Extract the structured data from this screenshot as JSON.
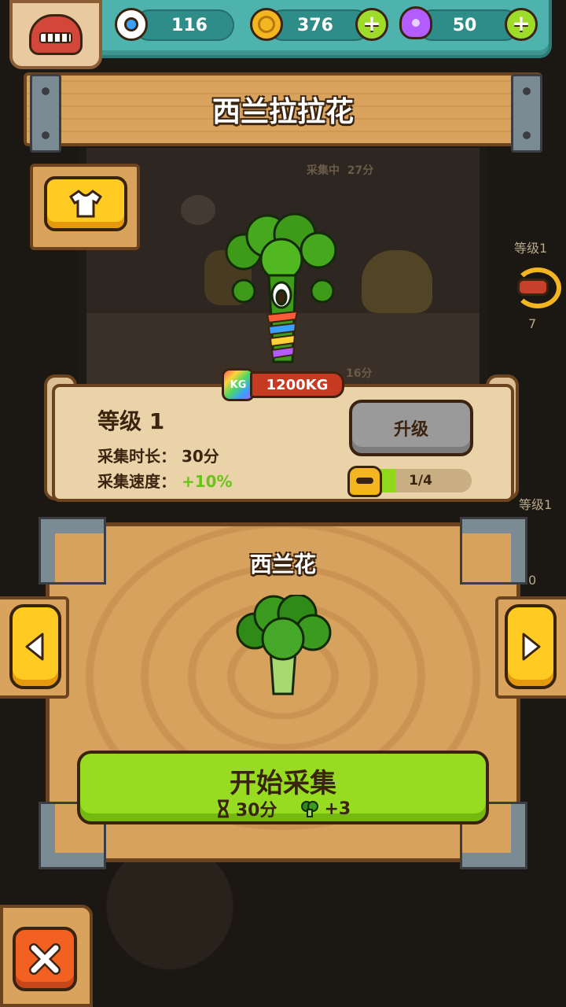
{
  "top_bar": {
    "eyeballs": "116",
    "coins": "376",
    "potions": "50"
  },
  "title": "西兰拉拉花",
  "scene": {
    "tag_top": "采集中",
    "tag_top_time": "27分",
    "tag_bottom": "16分",
    "weight": "1200KG",
    "kg_icon": "KG"
  },
  "side_hints": {
    "level_a": "等级1",
    "count_a": "7",
    "level_b": "等级1",
    "count_b": "0"
  },
  "info": {
    "level": "等级 1",
    "duration_label": "采集时长：",
    "duration_value": "30分",
    "speed_label": "采集速度：",
    "speed_value": "+10%",
    "upgrade_label": "升级",
    "progress_text": "1/4",
    "progress_fraction": 0.25
  },
  "panel": {
    "vegetable_name": "西兰花",
    "start_label": "开始采集",
    "start_time": "30分",
    "start_yield": "+3"
  },
  "colors": {
    "teal": "#4fb3ad",
    "wood": "#d7a25e",
    "green_button": "#98dc22",
    "yellow_button": "#ffcb23",
    "close_button": "#f26122"
  }
}
